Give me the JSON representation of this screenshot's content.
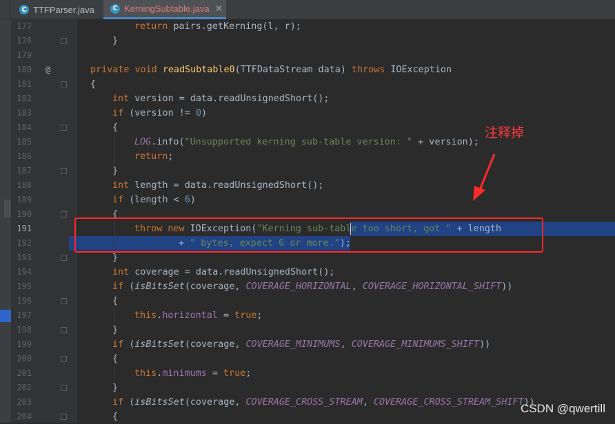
{
  "tabs": [
    {
      "label": "TTFParser.java",
      "icon": "java-class-icon",
      "icon_glyph": "C",
      "active": false
    },
    {
      "label": "KerningSubtable.java",
      "icon": "java-class-icon",
      "icon_glyph": "C",
      "active": true
    }
  ],
  "tab_close": "✕",
  "gutter_marker": "@",
  "editor": {
    "current_line": "191",
    "lines": [
      {
        "n": "177",
        "tokens": [
          [
            "kw",
            "return "
          ],
          [
            "",
            ""
          ],
          [
            "",
            "pairs.getKerning(l, r);"
          ]
        ]
      },
      {
        "n": "178",
        "tokens": [
          [
            "",
            "}"
          ]
        ]
      },
      {
        "n": "179",
        "tokens": []
      },
      {
        "n": "180",
        "tokens": [
          [
            "kw",
            "private void "
          ],
          [
            "fn",
            "readSubtable0"
          ],
          [
            "",
            "(TTFDataStream data) "
          ],
          [
            "kw",
            "throws "
          ],
          [
            "",
            "IOException"
          ]
        ]
      },
      {
        "n": "181",
        "tokens": [
          [
            "",
            "{"
          ]
        ]
      },
      {
        "n": "182",
        "tokens": [
          [
            "kw",
            "int "
          ],
          [
            "",
            "version = data.readUnsignedShort();"
          ]
        ]
      },
      {
        "n": "183",
        "tokens": [
          [
            "kw",
            "if "
          ],
          [
            "",
            "(version != "
          ],
          [
            "num",
            "0"
          ],
          [
            "",
            ")"
          ]
        ]
      },
      {
        "n": "184",
        "tokens": [
          [
            "",
            "{"
          ]
        ]
      },
      {
        "n": "185",
        "tokens": [
          [
            "st",
            "LOG"
          ],
          [
            "",
            ".info("
          ],
          [
            "str",
            "\"Unsupported kerning sub-table version: \""
          ],
          [
            "",
            " + version);"
          ]
        ]
      },
      {
        "n": "186",
        "tokens": [
          [
            "kw",
            "return"
          ],
          [
            "",
            ";"
          ]
        ]
      },
      {
        "n": "187",
        "tokens": [
          [
            "",
            "}"
          ]
        ]
      },
      {
        "n": "188",
        "tokens": [
          [
            "kw",
            "int "
          ],
          [
            "",
            "length = data.readUnsignedShort();"
          ]
        ]
      },
      {
        "n": "189",
        "tokens": [
          [
            "kw",
            "if "
          ],
          [
            "",
            "(length < "
          ],
          [
            "num",
            "6"
          ],
          [
            "",
            ")"
          ]
        ]
      },
      {
        "n": "190",
        "tokens": [
          [
            "",
            "{"
          ]
        ]
      },
      {
        "n": "191",
        "tokens": [
          [
            "kw",
            "throw new "
          ],
          [
            "",
            "IOException("
          ],
          [
            "str",
            "\"Kerning sub-table too short, got \""
          ],
          [
            "",
            " + length"
          ]
        ]
      },
      {
        "n": "192",
        "tokens": [
          [
            "",
            "+ "
          ],
          [
            "str",
            "\" bytes, expect 6 or more.\""
          ],
          [
            "",
            ");"
          ]
        ]
      },
      {
        "n": "193",
        "tokens": [
          [
            "",
            "}"
          ]
        ]
      },
      {
        "n": "194",
        "tokens": [
          [
            "kw",
            "int "
          ],
          [
            "",
            "coverage = data.readUnsignedShort();"
          ]
        ]
      },
      {
        "n": "195",
        "tokens": [
          [
            "kw",
            "if "
          ],
          [
            "",
            "("
          ],
          [
            "stm",
            "isBitsSet"
          ],
          [
            "",
            "(coverage, "
          ],
          [
            "st",
            "COVERAGE_HORIZONTAL"
          ],
          [
            "",
            ", "
          ],
          [
            "st",
            "COVERAGE_HORIZONTAL_SHIFT"
          ],
          [
            "",
            "))"
          ]
        ]
      },
      {
        "n": "196",
        "tokens": [
          [
            "",
            "{"
          ]
        ]
      },
      {
        "n": "197",
        "tokens": [
          [
            "kw",
            "this"
          ],
          [
            "",
            "."
          ],
          [
            "fld",
            "horizontal"
          ],
          [
            "",
            " = "
          ],
          [
            "kw",
            "true"
          ],
          [
            "",
            ";"
          ]
        ]
      },
      {
        "n": "198",
        "tokens": [
          [
            "",
            "}"
          ]
        ]
      },
      {
        "n": "199",
        "tokens": [
          [
            "kw",
            "if "
          ],
          [
            "",
            "("
          ],
          [
            "stm",
            "isBitsSet"
          ],
          [
            "",
            "(coverage, "
          ],
          [
            "st",
            "COVERAGE_MINIMUMS"
          ],
          [
            "",
            ", "
          ],
          [
            "st",
            "COVERAGE_MINIMUMS_SHIFT"
          ],
          [
            "",
            "))"
          ]
        ]
      },
      {
        "n": "200",
        "tokens": [
          [
            "",
            "{"
          ]
        ]
      },
      {
        "n": "201",
        "tokens": [
          [
            "kw",
            "this"
          ],
          [
            "",
            "."
          ],
          [
            "fld",
            "minimums"
          ],
          [
            "",
            " = "
          ],
          [
            "kw",
            "true"
          ],
          [
            "",
            ";"
          ]
        ]
      },
      {
        "n": "202",
        "tokens": [
          [
            "",
            "}"
          ]
        ]
      },
      {
        "n": "203",
        "tokens": [
          [
            "kw",
            "if "
          ],
          [
            "",
            "("
          ],
          [
            "stm",
            "isBitsSet"
          ],
          [
            "",
            "(coverage, "
          ],
          [
            "st",
            "COVERAGE_CROSS_STREAM"
          ],
          [
            "",
            ", "
          ],
          [
            "st",
            "COVERAGE_CROSS_STREAM_SHIFT"
          ],
          [
            "",
            "))"
          ]
        ]
      },
      {
        "n": "204",
        "tokens": [
          [
            "",
            "{"
          ]
        ]
      }
    ]
  },
  "annotation": "注释掉",
  "watermark": "CSDN @qwertill",
  "colors": {
    "keyword": "#cc7832",
    "string": "#6a8759",
    "number": "#6897bb",
    "method": "#ffc66d",
    "static": "#9876aa",
    "annotation": "#ff2a2a",
    "selection": "#214283"
  }
}
